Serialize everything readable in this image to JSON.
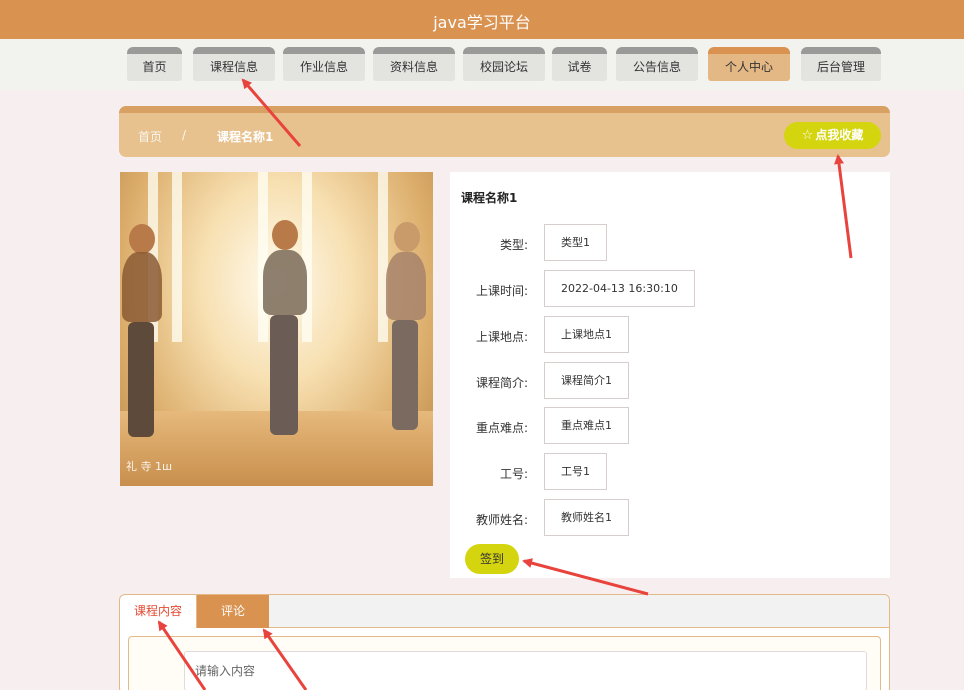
{
  "app": {
    "title": "java学习平台"
  },
  "nav": {
    "items": [
      {
        "label": "首页"
      },
      {
        "label": "课程信息"
      },
      {
        "label": "作业信息"
      },
      {
        "label": "资料信息"
      },
      {
        "label": "校园论坛"
      },
      {
        "label": "试卷"
      },
      {
        "label": "公告信息"
      },
      {
        "label": "个人中心"
      },
      {
        "label": "后台管理"
      }
    ],
    "active_index": 7
  },
  "breadcrumb": {
    "home": "首页",
    "separator": "/",
    "current": "课程名称1"
  },
  "favorite": {
    "label": "点我收藏",
    "icon": "star-icon"
  },
  "course": {
    "name": "课程名称1",
    "fields": [
      {
        "label": "类型:",
        "value": "类型1"
      },
      {
        "label": "上课时间:",
        "value": "2022-04-13 16:30:10"
      },
      {
        "label": "上课地点:",
        "value": "上课地点1"
      },
      {
        "label": "课程简介:",
        "value": "课程简介1"
      },
      {
        "label": "重点难点:",
        "value": "重点难点1"
      },
      {
        "label": "工号:",
        "value": "工号1"
      },
      {
        "label": "教师姓名:",
        "value": "教师姓名1"
      }
    ],
    "signin_label": "签到"
  },
  "photo": {
    "watermark": "礼 寺 1ш"
  },
  "tabs": [
    {
      "label": "课程内容"
    },
    {
      "label": "评论"
    }
  ],
  "editor": {
    "placeholder": "请输入内容"
  },
  "colors": {
    "header": "#d9924f",
    "accent": "#d4d40f",
    "active_tab_text": "#e34a33",
    "annotation_arrow": "#e8433d"
  }
}
